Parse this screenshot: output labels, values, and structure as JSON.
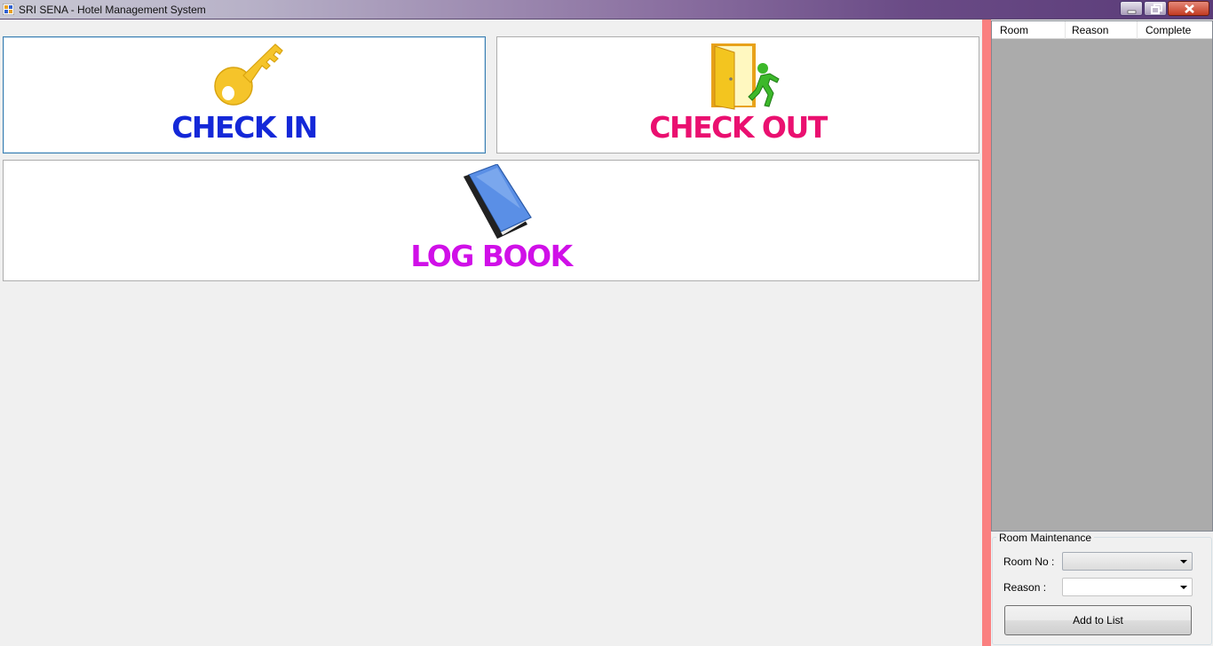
{
  "window": {
    "title": "SRI SENA - Hotel Management System"
  },
  "buttons": {
    "check_in": {
      "label": "CHECK IN",
      "icon": "key-icon",
      "color": "#1428d8"
    },
    "check_out": {
      "label": "CHECK OUT",
      "icon": "exit-door-icon",
      "color": "#ea1070"
    },
    "log_book": {
      "label": "LOG BOOK",
      "icon": "book-icon",
      "color": "#d010e8"
    }
  },
  "maintenance_list": {
    "columns": [
      "Room",
      "Reason",
      "Complete"
    ],
    "rows": []
  },
  "room_maintenance": {
    "title": "Room Maintenance",
    "room_no_label": "Room No :",
    "room_no_value": "",
    "reason_label": "Reason :",
    "reason_value": "",
    "add_button": "Add to List"
  },
  "colors": {
    "side_bar": "#fa8080",
    "list_bg": "#ababab"
  }
}
